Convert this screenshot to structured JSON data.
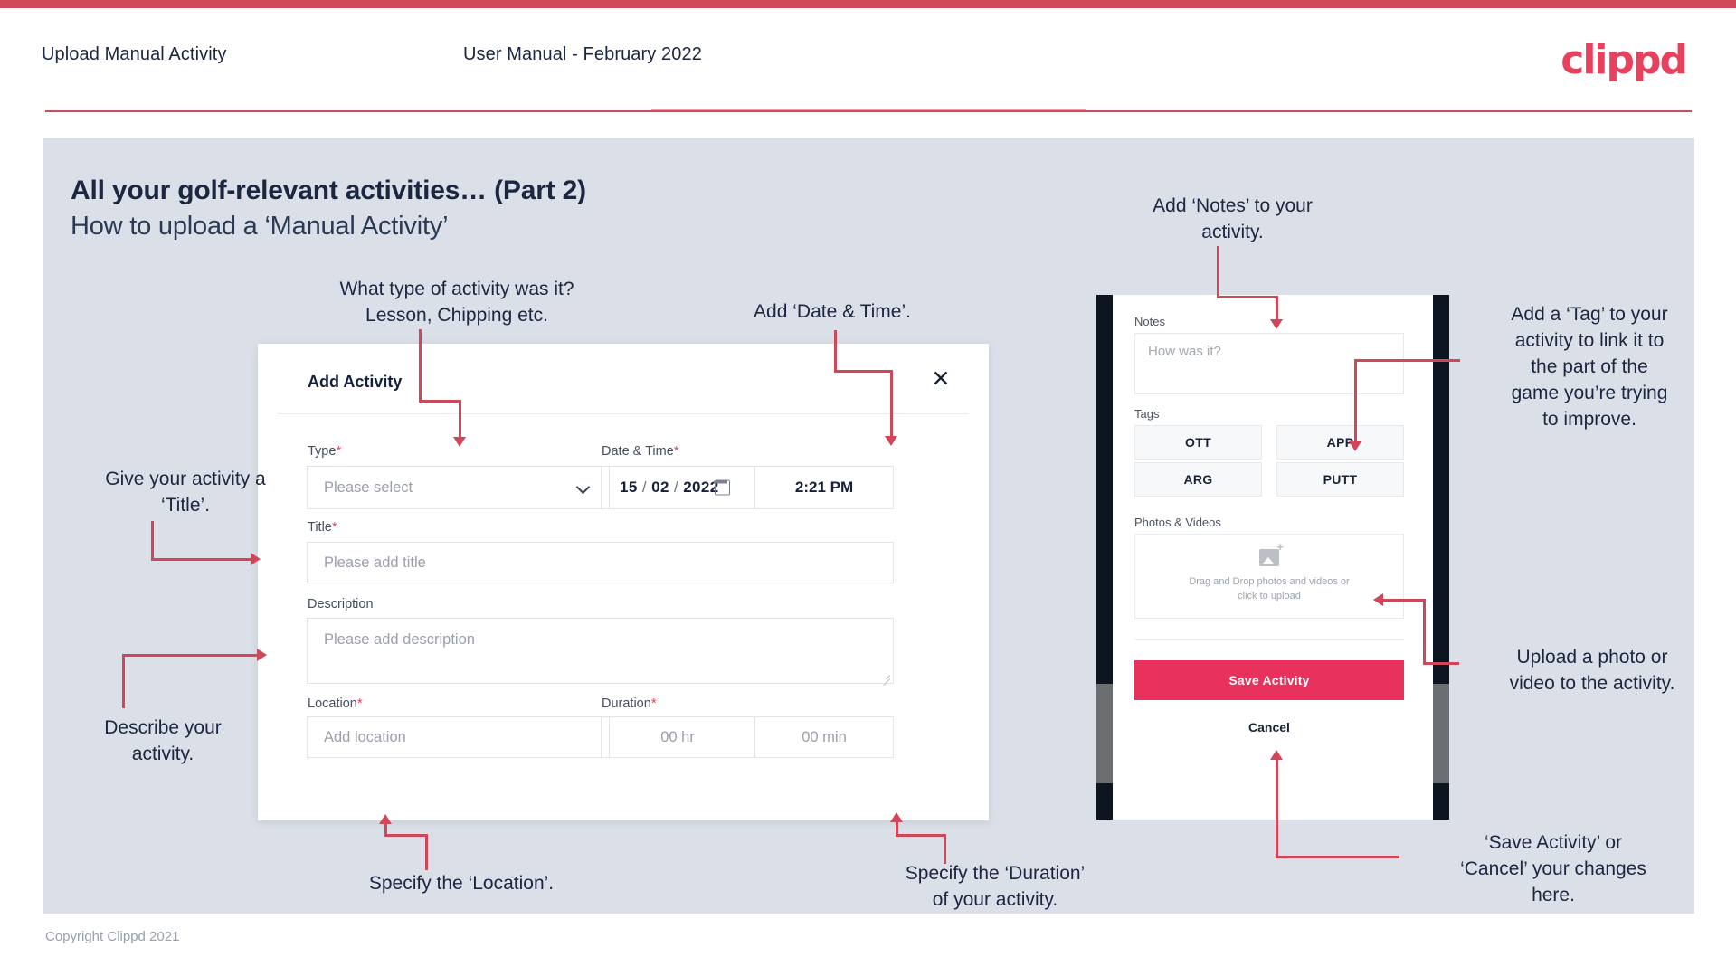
{
  "header": {
    "left_title": "Upload Manual Activity",
    "center_title": "User Manual - February 2022",
    "logo": "clippd"
  },
  "slide": {
    "title": "All your golf-relevant activities… (Part 2)",
    "subtitle": "How to upload a ‘Manual Activity’"
  },
  "dialog": {
    "title": "Add Activity",
    "close_icon": "close-icon",
    "fields": {
      "type_label": "Type",
      "type_placeholder": "Please select",
      "datetime_label": "Date & Time",
      "date_day": "15",
      "date_month": "02",
      "date_year": "2022",
      "date_sep": "/",
      "time_value": "2:21 PM",
      "title_label": "Title",
      "title_placeholder": "Please add title",
      "description_label": "Description",
      "description_placeholder": "Please add description",
      "location_label": "Location",
      "location_placeholder": "Add location",
      "duration_label": "Duration",
      "duration_hr": "00 hr",
      "duration_min": "00 min",
      "required_mark": "*"
    }
  },
  "phone": {
    "notes_label": "Notes",
    "notes_placeholder": "How was it?",
    "tags_label": "Tags",
    "tags": [
      "OTT",
      "APP",
      "ARG",
      "PUTT"
    ],
    "photos_label": "Photos & Videos",
    "dropzone_line1": "Drag and Drop photos and videos or",
    "dropzone_line2": "click to upload",
    "save_label": "Save Activity",
    "cancel_label": "Cancel"
  },
  "callouts": {
    "type": "What type of activity was it?\nLesson, Chipping etc.",
    "datetime": "Add ‘Date & Time’.",
    "title": "Give your activity a\n‘Title’.",
    "description": "Describe your\nactivity.",
    "location": "Specify the ‘Location’.",
    "duration": "Specify the ‘Duration’\nof your activity.",
    "notes": "Add ‘Notes’ to your\nactivity.",
    "tags": "Add a ‘Tag’ to your\nactivity to link it to\nthe part of the\ngame you’re trying\nto improve.",
    "photos": "Upload a photo or\nvideo to the activity.",
    "save": "‘Save Activity’ or\n‘Cancel’ your changes\nhere."
  },
  "footer": {
    "copyright": "Copyright Clippd 2021"
  },
  "colors": {
    "brand_pink": "#e8415d",
    "accent_red": "#cf4759",
    "slide_bg": "#dbe0e8",
    "text_dark": "#1b2640"
  }
}
